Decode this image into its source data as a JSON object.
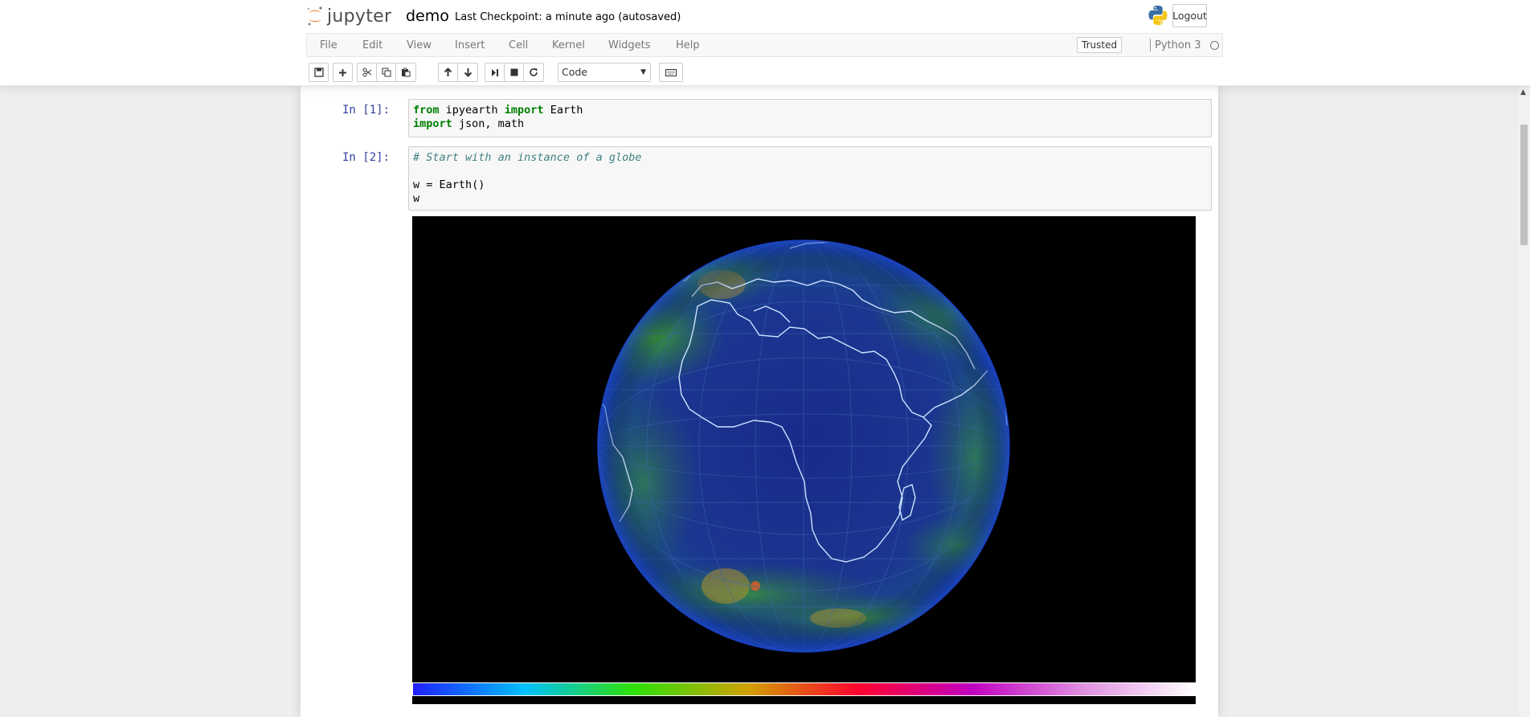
{
  "header": {
    "logo_text": "jupyter",
    "notebook_name": "demo",
    "checkpoint": "Last Checkpoint: a minute ago (autosaved)",
    "logout_label": "Logout"
  },
  "menubar": {
    "items": [
      "File",
      "Edit",
      "View",
      "Insert",
      "Cell",
      "Kernel",
      "Widgets",
      "Help"
    ],
    "trusted_label": "Trusted",
    "kernel_name": "Python 3"
  },
  "toolbar": {
    "cell_type": "Code",
    "buttons": [
      "save-icon",
      "plus-icon",
      "cut-icon",
      "copy-icon",
      "paste-icon",
      "arrow-up-icon",
      "arrow-down-icon",
      "run-icon",
      "stop-icon",
      "restart-icon",
      "keyboard-icon"
    ]
  },
  "cells": [
    {
      "prompt": "In [1]:",
      "lines": [
        {
          "kw1": "from",
          "t1": " ipyearth ",
          "kw2": "import",
          "t2": " Earth"
        },
        {
          "kw1": "import",
          "t1": " json, math",
          "kw2": "",
          "t2": ""
        }
      ]
    },
    {
      "prompt": "In [2]:",
      "comment": "# Start with an instance of a globe",
      "line3": "w = Earth()",
      "line4": "w"
    }
  ],
  "output": {
    "colorbar_colors": [
      "#2020ff",
      "#00c0ff",
      "#30e000",
      "#d0a000",
      "#ff0030",
      "#c000c0",
      "#e090e0",
      "#ffffff"
    ]
  },
  "colors": {
    "prompt": "#303f9f",
    "keyword": "#008000",
    "comment": "#408080"
  }
}
